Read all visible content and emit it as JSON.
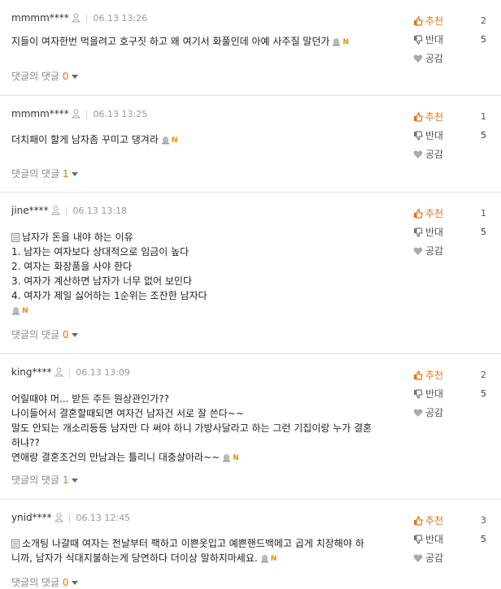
{
  "reply_label": "댓글의 댓글",
  "vote_labels": {
    "up": "추천",
    "down": "반대",
    "like": "공감"
  },
  "comments": [
    {
      "user": "mmmm****",
      "time": "06.13 13:26",
      "lines": [
        "지들이 여자한번 먹을려고 호구짓 하고 왜 여기서 화풀인데 아예 사주질 말던가"
      ],
      "reply_count": "0",
      "up": "2",
      "down": "5"
    },
    {
      "user": "mmmm****",
      "time": "06.13 13:25",
      "lines": [
        "더치패이 할게 남자좀 꾸미고 댕겨라"
      ],
      "reply_count": "1",
      "up": "1",
      "down": "5"
    },
    {
      "user": "jine****",
      "time": "06.13 13:18",
      "lines": [
        "남자가 돈을 내야 하는 이유",
        "1. 남자는 여자보다 상대적으로 임금이 높다",
        "2. 여자는 화장품을 사야 한다",
        "3. 여자가 계산하면 남자가 너무 없어 보인다",
        "4. 여자가 제일 싫어하는 1순위는 조잔한 남자다"
      ],
      "reply_count": "0",
      "up": "1",
      "down": "5"
    },
    {
      "user": "king****",
      "time": "06.13 13:09",
      "lines": [
        "어릴때야 머... 받든 주든 뭔상관인가??",
        "나이들어서 결혼할때되면 여자건 남자건 서로 잘 쓴다~~",
        "말도 안되는 개소리등등 남자만 다 써야 하니 가방사달라고 하는 그런 기집이랑 누가 결혼",
        "하냐??",
        "연애랑 결혼조건의 만남과는 틀리니 대충살아라~~"
      ],
      "reply_count": "1",
      "up": "2",
      "down": "5"
    },
    {
      "user": "ynid****",
      "time": "06.13 12:45",
      "lines": [
        "소개팅 나갈때 여자는 전날부터 팩하고 이쁜옷입고 예쁜핸드백메고 곱게 치장해야 하",
        "니까, 남자가 식대지불하는게 당연하다 더이상 말하지마세요."
      ],
      "reply_count": "0",
      "up": "3",
      "down": "5"
    }
  ]
}
